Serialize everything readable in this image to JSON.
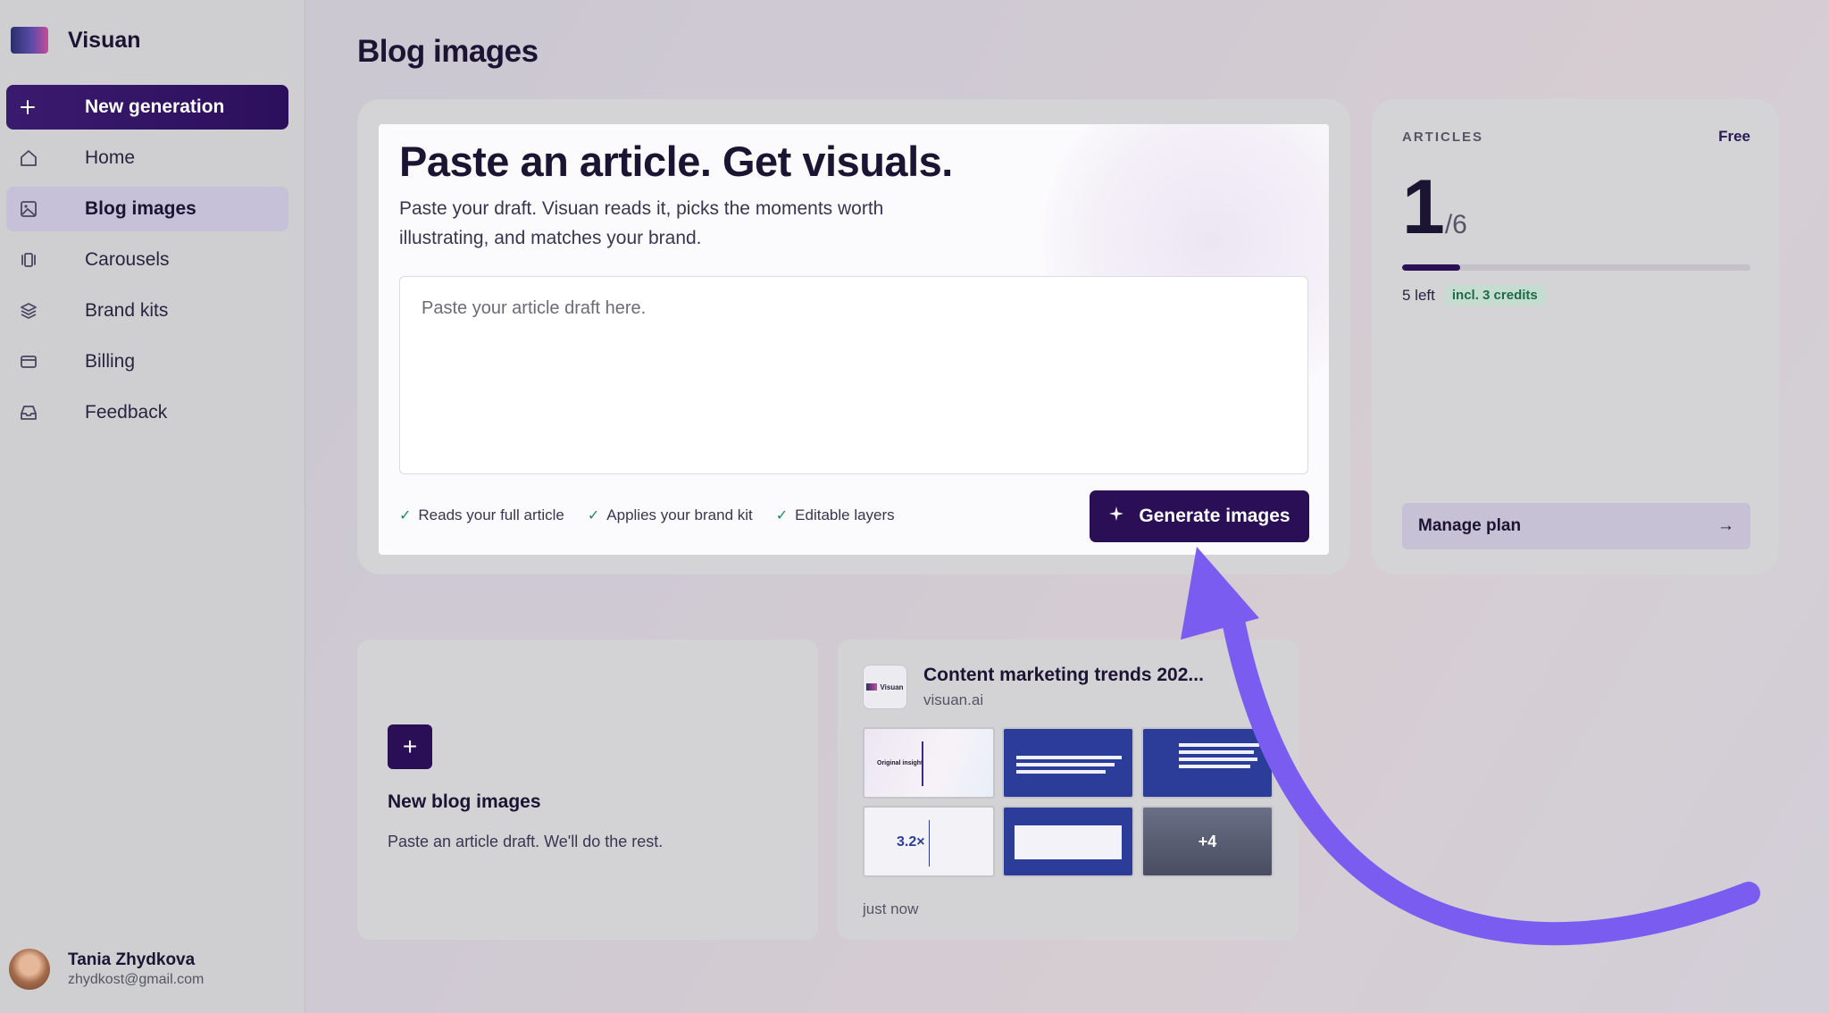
{
  "app": {
    "name": "Visuan"
  },
  "sidebar": {
    "items": [
      {
        "label": "New generation",
        "icon": "plus-icon"
      },
      {
        "label": "Home",
        "icon": "home-icon"
      },
      {
        "label": "Blog images",
        "icon": "image-icon"
      },
      {
        "label": "Carousels",
        "icon": "carousel-icon"
      },
      {
        "label": "Brand kits",
        "icon": "layers-icon"
      },
      {
        "label": "Billing",
        "icon": "credit-card-icon"
      },
      {
        "label": "Feedback",
        "icon": "inbox-icon"
      }
    ],
    "active": "Blog images"
  },
  "user": {
    "name": "Tania Zhydkova",
    "email": "zhydkost@gmail.com"
  },
  "page": {
    "title": "Blog images"
  },
  "generator": {
    "headline": "Paste an article. Get visuals.",
    "subtitle": "Paste your draft. Visuan reads it, picks the moments worth illustrating, and matches your brand.",
    "placeholder": "Paste your article draft here.",
    "features": [
      "Reads your full article",
      "Applies your brand kit",
      "Editable layers"
    ],
    "button": "Generate images",
    "button_icon": "sparkle-icon"
  },
  "articles": {
    "label": "ARTICLES",
    "plan": "Free",
    "used": "1",
    "total": "/6",
    "progress_fraction": 0.1667,
    "left": "5 left",
    "credits": "incl. 3 credits",
    "manage": "Manage plan",
    "manage_arrow": "→"
  },
  "new_card": {
    "plus": "+",
    "title": "New blog images",
    "description": "Paste an article draft. We'll do the rest."
  },
  "post_card": {
    "logo_text": "Visuan",
    "title": "Content marketing trends 202...",
    "domain": "visuan.ai",
    "thumbnails": {
      "t1_text": "Original insight",
      "t4_stat": "3.2×",
      "t6_more": "+4"
    },
    "time": "just now"
  },
  "colors": {
    "primary": "#2a0e56",
    "accent_arrow": "#7b5cf0",
    "success": "#1f8a5a"
  }
}
